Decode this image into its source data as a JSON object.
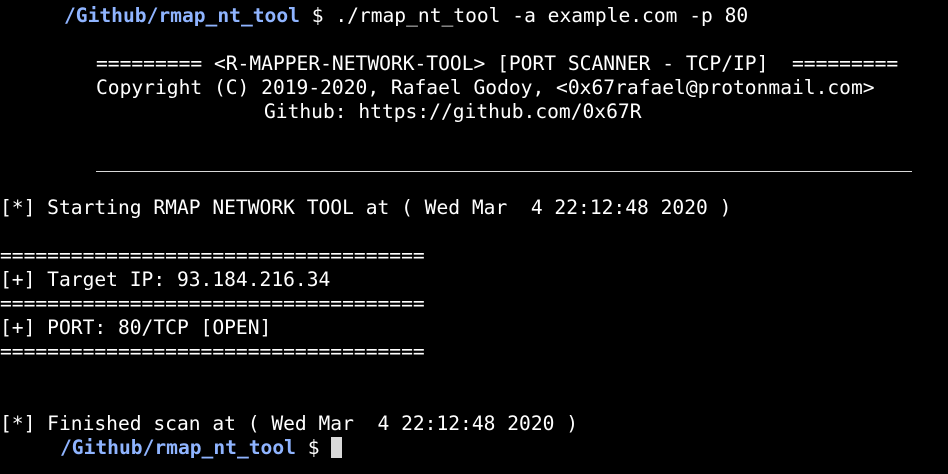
{
  "prompt_top": {
    "cwd": "/Github/rmap_nt_tool",
    "symbol": "$",
    "command": "./rmap_nt_tool -a example.com -p 80"
  },
  "banner": {
    "title": "========= <R-MAPPER-NETWORK-TOOL> [PORT SCANNER - TCP/IP]  =========",
    "copyright": "Copyright (C) 2019-2020, Rafael Godoy, <0x67rafael@protonmail.com>",
    "github": "Github: https://github.com/0x67R"
  },
  "output": {
    "start": "[*] Starting RMAP NETWORK TOOL at ( Wed Mar  4 22:12:48 2020 )",
    "separator": "====================================",
    "target": "[+] Target IP: 93.184.216.34",
    "port": "[+] PORT: 80/TCP [OPEN]",
    "finish": "[*] Finished scan at ( Wed Mar  4 22:12:48 2020 )"
  },
  "prompt_bottom": {
    "cwd": "/Github/rmap_nt_tool",
    "symbol": "$"
  },
  "colors": {
    "background": "#000000",
    "text": "#ffffff",
    "path": "#8fb4ff",
    "cursor": "#d9d9d9"
  }
}
